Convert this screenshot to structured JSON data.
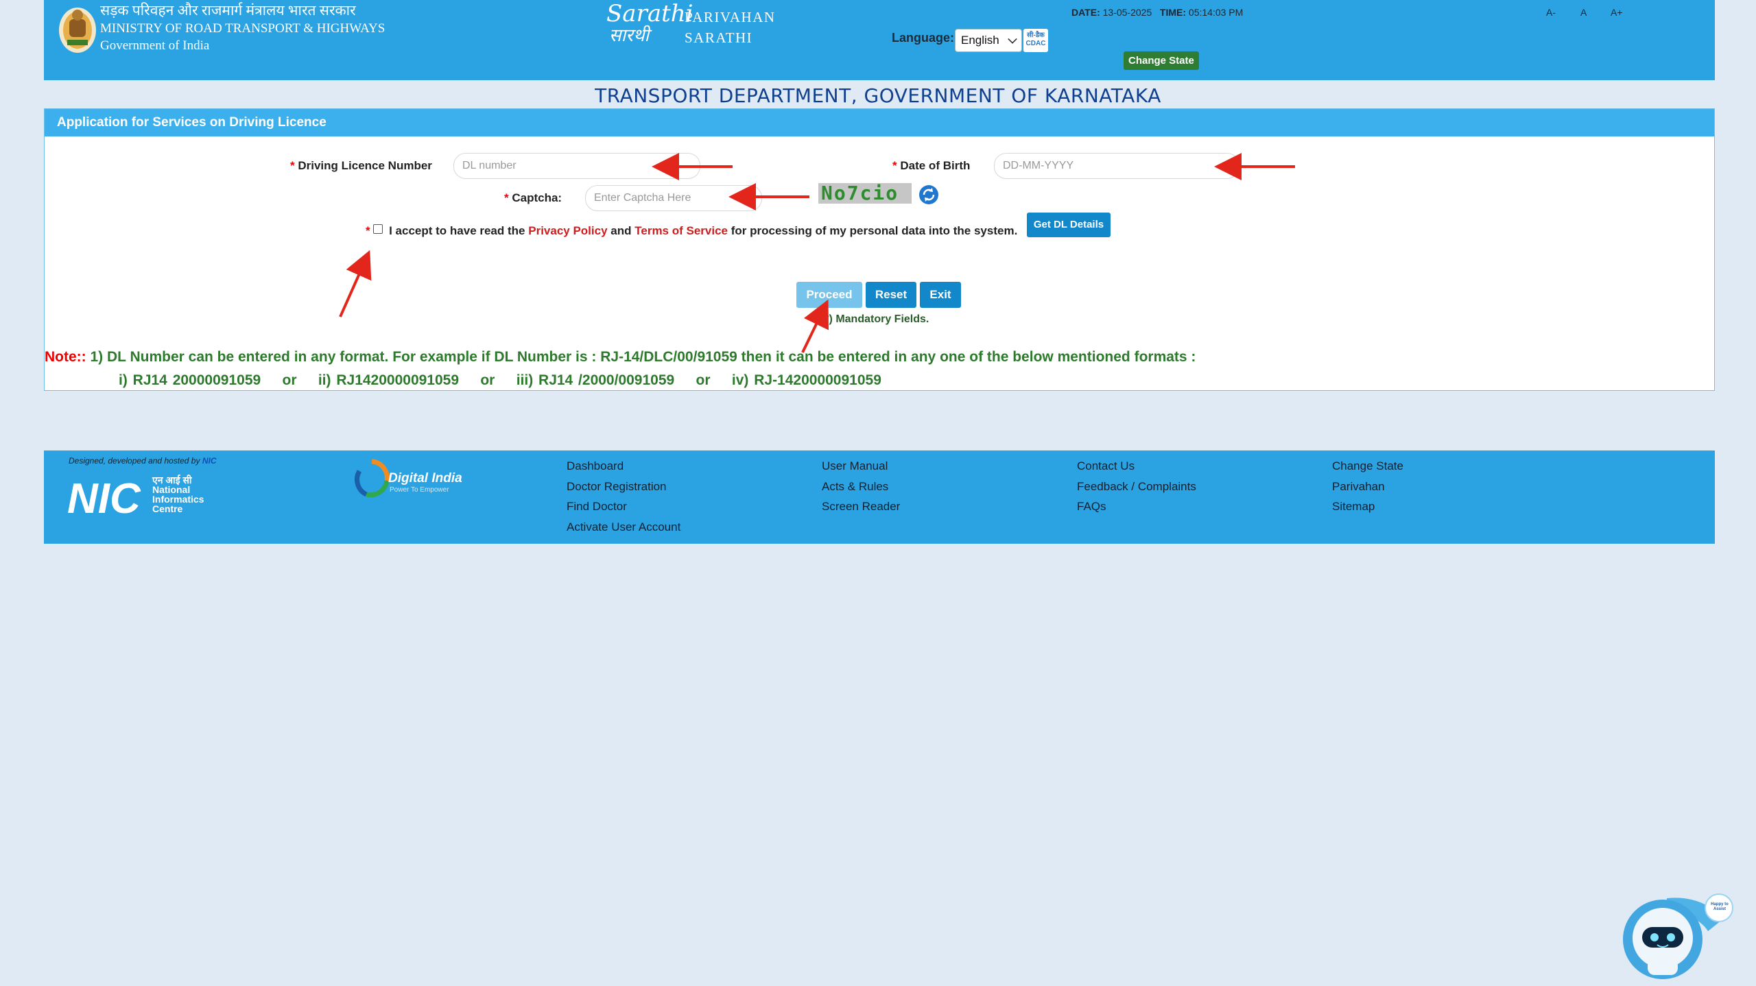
{
  "header": {
    "ministry_hindi": "सड़क परिवहन और राजमार्ग मंत्रालय भारत सरकार",
    "ministry_english": "MINISTRY OF ROAD TRANSPORT & HIGHWAYS",
    "government": "Government of India",
    "logo_script": "Sarathi",
    "brand_line1": "PARIVAHAN",
    "brand_line2": "SARATHI",
    "language_label": "Language:",
    "language_value": "English",
    "cdac_label": "सी-डैक CDAC",
    "date_label": "DATE:",
    "date_value": "13-05-2025",
    "time_label": "TIME:",
    "time_value": "05:14:03 PM",
    "change_state": "Change State",
    "font_small": "A-",
    "font_normal": "A",
    "font_large": "A+"
  },
  "page_title": "TRANSPORT DEPARTMENT, GOVERNMENT OF KARNATAKA",
  "form": {
    "heading": "Application for Services on Driving Licence",
    "required_mark": "*",
    "dl_label": "Driving Licence Number",
    "dl_placeholder": "DL number",
    "dob_label": "Date of Birth",
    "dob_placeholder": "DD-MM-YYYY",
    "captcha_label": "Captcha:",
    "captcha_placeholder": "Enter Captcha Here",
    "captcha_text": "No7cio",
    "consent_prefix": "I accept to have read the",
    "privacy_policy": "Privacy Policy",
    "consent_and": "and",
    "terms": "Terms of Service",
    "consent_suffix": "for processing of my personal data into the system.",
    "get_dl_details": "Get DL Details",
    "proceed": "Proceed",
    "reset": "Reset",
    "exit": "Exit",
    "mandatory_note": "(*) Mandatory Fields.",
    "note_label": "Note::",
    "note_line1": "1) DL Number can be entered in any format. For example if DL Number is : RJ-14/DLC/00/91059 then it can be entered in any one of the below mentioned formats :",
    "note_line2": "i) RJ14 20000091059    or    ii) RJ1420000091059    or    iii) RJ14 /2000/0091059    or    iv) RJ-1420000091059"
  },
  "footer": {
    "designed_by": "Designed, developed and hosted by",
    "designed_org": "NIC",
    "nic_hindi": "एन आई सी",
    "nic_line1": "National",
    "nic_line2": "Informatics",
    "nic_line3": "Centre",
    "digital_india": "Digital India",
    "digital_india_tag": "Power To Empower",
    "col1": [
      "Dashboard",
      "Doctor Registration",
      "Find Doctor",
      "Activate User Account"
    ],
    "col2": [
      "User Manual",
      "Acts & Rules",
      "Screen Reader"
    ],
    "col3": [
      "Contact Us",
      "Feedback / Complaints",
      "FAQs"
    ],
    "col4": [
      "Change State",
      "Parivahan",
      "Sitemap"
    ]
  },
  "chatbot": {
    "bubble_text": "Happy to Assist"
  },
  "colors": {
    "header_bg": "#2ba3e2",
    "page_bg": "#dfeaf4",
    "title": "#0f3f8f",
    "note_green": "#2d7a2d",
    "required_red": "#e00000",
    "button_blue": "#1287c9"
  }
}
